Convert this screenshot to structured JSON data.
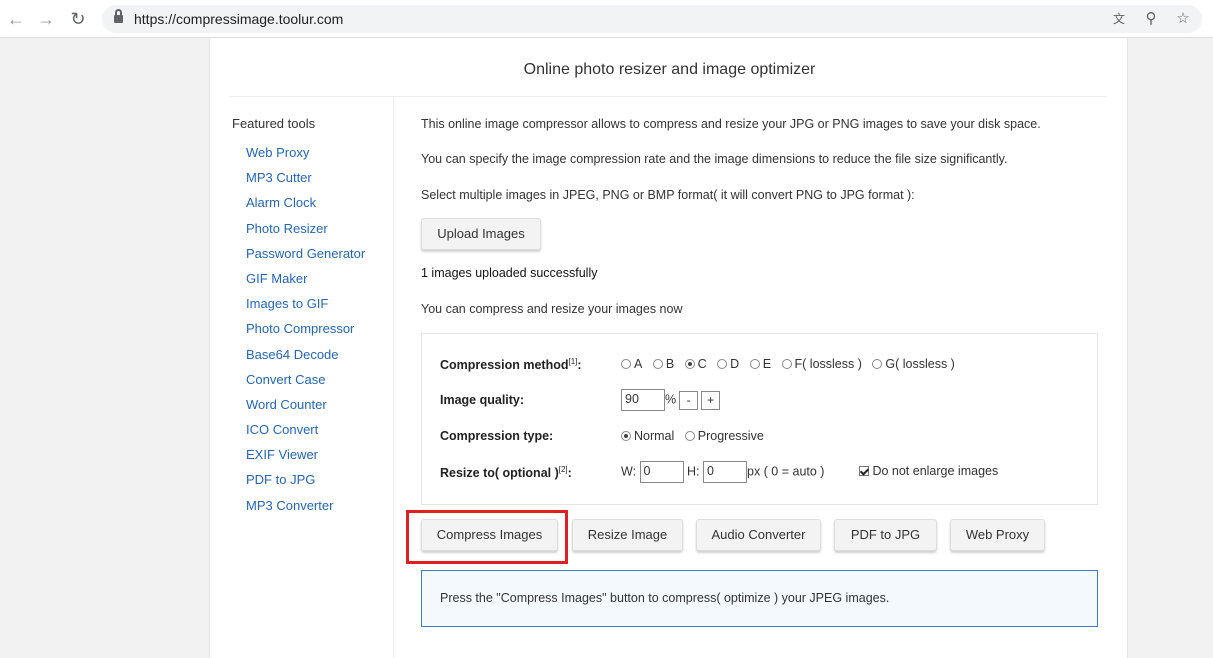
{
  "browser": {
    "url": "https://compressimage.toolur.com",
    "icons": [
      "back-arrow-icon",
      "forward-arrow-icon",
      "reload-icon",
      "lock-icon",
      "translate-icon",
      "zoom-icon",
      "bookmark-star-icon"
    ]
  },
  "page": {
    "title": "Online photo resizer and image optimizer"
  },
  "sidebar": {
    "heading": "Featured tools",
    "items": [
      "Web Proxy",
      "MP3 Cutter",
      "Alarm Clock",
      "Photo Resizer",
      "Password Generator",
      "GIF Maker",
      "Images to GIF",
      "Photo Compressor",
      "Base64 Decode",
      "Convert Case",
      "Word Counter",
      "ICO Convert",
      "EXIF Viewer",
      "PDF to JPG",
      "MP3 Converter"
    ]
  },
  "main": {
    "intro1": "This online image compressor allows to compress and resize your JPG or PNG images to save your disk space.",
    "intro2": "You can specify the image compression rate and the image dimensions to reduce the file size significantly.",
    "intro3": "Select multiple images in JPEG, PNG or BMP format( it will convert PNG to JPG format ):",
    "upload_label": "Upload Images",
    "upload_status": "1 images uploaded successfully",
    "ready_text": "You can compress and resize your images now",
    "options": {
      "method_label": "Compression method",
      "method_note": "[1]",
      "methods": [
        "A",
        "B",
        "C",
        "D",
        "E",
        "F( lossless )",
        "G( lossless )"
      ],
      "method_selected": "C",
      "quality_label": "Image quality:",
      "quality_value": "90",
      "percent": "%",
      "minus": "-",
      "plus": "+",
      "type_label": "Compression type:",
      "type_normal": "Normal",
      "type_progressive": "Progressive",
      "resize_label": "Resize to( optional )",
      "resize_note": "[2]",
      "w_label": "W:",
      "w_value": "0",
      "h_label": "H:",
      "h_value": "0",
      "px_note": "px ( 0 = auto )",
      "no_enlarge": "Do not enlarge images"
    },
    "actions": [
      "Compress Images",
      "Resize Image",
      "Audio Converter",
      "PDF to JPG",
      "Web Proxy"
    ],
    "info": "Press the \"Compress Images\" button to compress( optimize ) your JPEG images."
  },
  "colors": {
    "link": "#2266bb",
    "highlight": "#e02020",
    "info_border": "#3d7bbf"
  }
}
